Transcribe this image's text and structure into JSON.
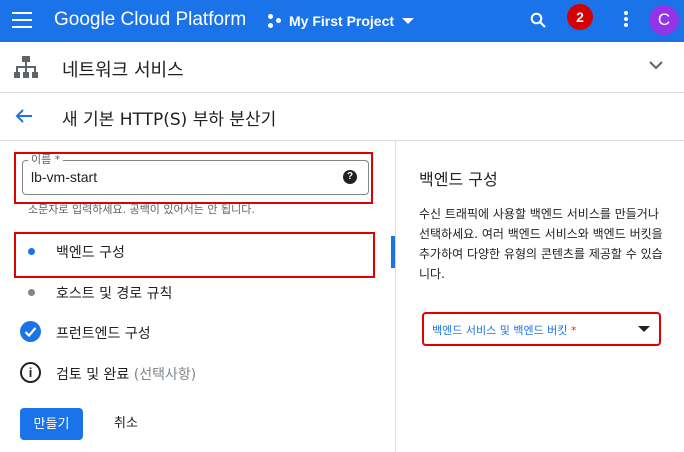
{
  "appbar": {
    "brand": "Google Cloud Platform",
    "project": "My First Project",
    "notification_count": "2",
    "avatar_initial": "C",
    "color": "#1a73e8"
  },
  "product": {
    "title": "네트워크 서비스"
  },
  "page": {
    "title": "새 기본 HTTP(S) 부하 분산기"
  },
  "name_field": {
    "label": "이름 *",
    "value": "lb-vm-start",
    "hint": "소문자로 입력하세요. 공백이 있어서는 안 됩니다."
  },
  "steps": [
    {
      "label": "백엔드 구성",
      "state": "active"
    },
    {
      "label": "호스트 및 경로 규칙",
      "state": "pending"
    },
    {
      "label": "프런트엔드 구성",
      "state": "complete"
    },
    {
      "label": "검토 및 완료",
      "optional": "(선택사항)",
      "state": "info"
    }
  ],
  "actions": {
    "create": "만들기",
    "cancel": "취소"
  },
  "backend_config": {
    "title": "백엔드 구성",
    "description": "수신 트래픽에 사용할 백엔드 서비스를 만들거나 선택하세요. 여러 백엔드 서비스와 백엔드 버킷을 추가하여 다양한 유형의 콘텐츠를 제공할 수 있습니다.",
    "select_label": "백엔드 서비스 및 백엔드 버킷",
    "required_mark": "*"
  }
}
